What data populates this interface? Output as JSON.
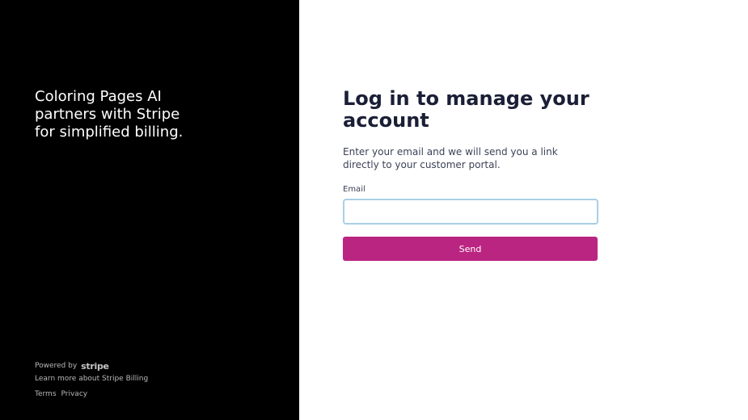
{
  "left_panel": {
    "tagline": "Coloring Pages AI partners with Stripe for simplified billing.",
    "powered_by": "Powered by",
    "brand": "stripe",
    "learn_more": "Learn more about Stripe Billing",
    "terms": "Terms",
    "privacy": "Privacy"
  },
  "login": {
    "heading": "Log in to manage your account",
    "description": "Enter your email and we will send you a link directly to your customer portal.",
    "email_label": "Email",
    "email_value": "",
    "send_label": "Send"
  },
  "colors": {
    "left_background": "#000000",
    "accent": "#bb2582",
    "input_focus_border": "#a9cfe6",
    "heading_text": "#1a1f36"
  }
}
